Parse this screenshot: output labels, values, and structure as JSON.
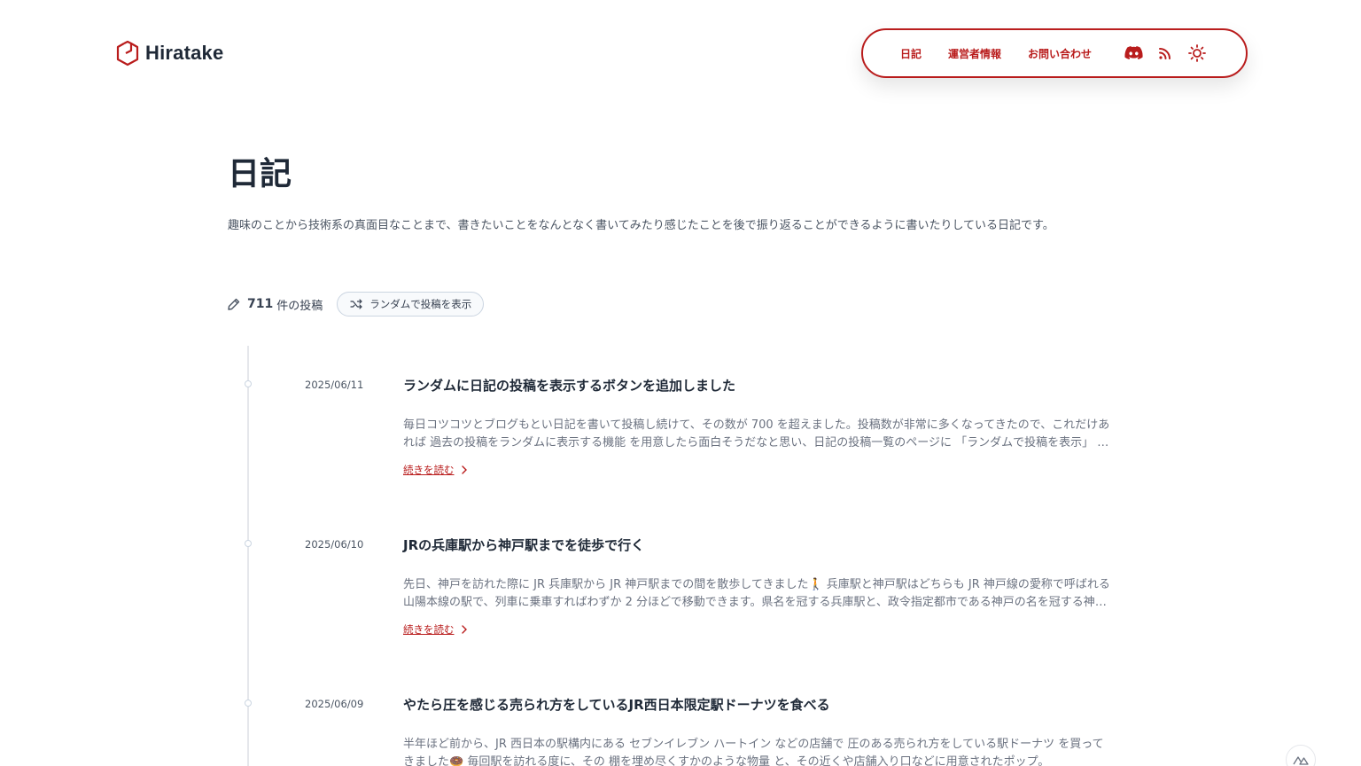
{
  "brand": {
    "name": "Hiratake",
    "accent": "#b91c1c"
  },
  "nav": {
    "links": [
      "日記",
      "運営者情報",
      "お問い合わせ"
    ],
    "icons": [
      "discord-icon",
      "rss-icon",
      "sun-icon"
    ]
  },
  "page": {
    "title": "日記",
    "description": "趣味のことから技術系の真面目なことまで、書きたいことをなんとなく書いてみたり感じたことを後で振り返ることができるように書いたりしている日記です。"
  },
  "meta": {
    "count": "711",
    "count_label": "件の投稿",
    "random_label": "ランダムで投稿を表示"
  },
  "read_more_label": "続きを読む",
  "posts": [
    {
      "date": "2025/06/11",
      "title": "ランダムに日記の投稿を表示するボタンを追加しました",
      "excerpt": "毎日コツコツとブログもとい日記を書いて投稿し続けて、その数が 700 を超えました。投稿数が非常に多くなってきたので、これだけあれば 過去の投稿をランダムに表示する機能 を用意したら面白そうだなと思い、日記の投稿一覧のページに 「ランダムで投稿を表示」 ボタンを追加しました。"
    },
    {
      "date": "2025/06/10",
      "title": "JRの兵庫駅から神戸駅までを徒歩で行く",
      "excerpt": "先日、神戸を訪れた際に JR 兵庫駅から JR 神戸駅までの間を散歩してきました🚶 兵庫駅と神戸駅はどちらも JR 神戸線の愛称で呼ばれる山陽本線の駅で、列車に乗車すればわずか 2 分ほどで移動できます。県名を冠する兵庫駅と、政令指定都市である神戸の名を冠する神戸駅。"
    },
    {
      "date": "2025/06/09",
      "title": "やたら圧を感じる売られ方をしているJR西日本限定駅ドーナツを食べる",
      "excerpt": "半年ほど前から、JR 西日本の駅構内にある セブンイレブン ハートイン などの店舗で 圧のある売られ方をしている駅ドーナツ を買ってきました🍩 毎回駅を訪れる度に、その 棚を埋め尽くすかのような物量 と、その近くや店舗入り口などに用意されたポップ。"
    }
  ]
}
